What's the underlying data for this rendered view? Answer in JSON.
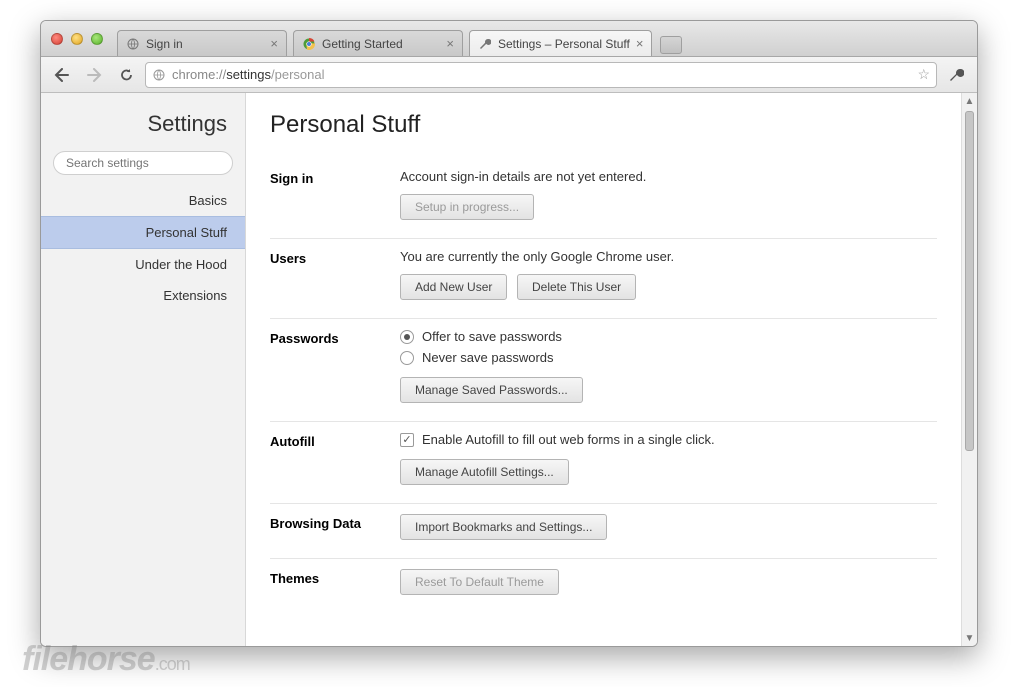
{
  "tabs": [
    {
      "title": "Sign in",
      "favicon": "globe"
    },
    {
      "title": "Getting Started",
      "favicon": "chrome"
    },
    {
      "title": "Settings – Personal Stuff",
      "favicon": "wrench",
      "active": true
    }
  ],
  "omnibox": {
    "scheme": "chrome://",
    "host": "settings",
    "path": "/personal"
  },
  "sidebar": {
    "title": "Settings",
    "search_placeholder": "Search settings",
    "items": [
      {
        "label": "Basics"
      },
      {
        "label": "Personal Stuff",
        "selected": true
      },
      {
        "label": "Under the Hood"
      },
      {
        "label": "Extensions"
      }
    ]
  },
  "page": {
    "title": "Personal Stuff",
    "signin": {
      "label": "Sign in",
      "status": "Account sign-in details are not yet entered.",
      "button": "Setup in progress..."
    },
    "users": {
      "label": "Users",
      "status": "You are currently the only Google Chrome user.",
      "add_button": "Add New User",
      "delete_button": "Delete This User"
    },
    "passwords": {
      "label": "Passwords",
      "option_offer": "Offer to save passwords",
      "option_never": "Never save passwords",
      "manage_button": "Manage Saved Passwords..."
    },
    "autofill": {
      "label": "Autofill",
      "checkbox_label": "Enable Autofill to fill out web forms in a single click.",
      "manage_button": "Manage Autofill Settings..."
    },
    "browsing_data": {
      "label": "Browsing Data",
      "import_button": "Import Bookmarks and Settings..."
    },
    "themes": {
      "label": "Themes",
      "reset_button": "Reset To Default Theme"
    }
  },
  "watermark": {
    "brand": "filehorse",
    "suffix": ".com"
  }
}
